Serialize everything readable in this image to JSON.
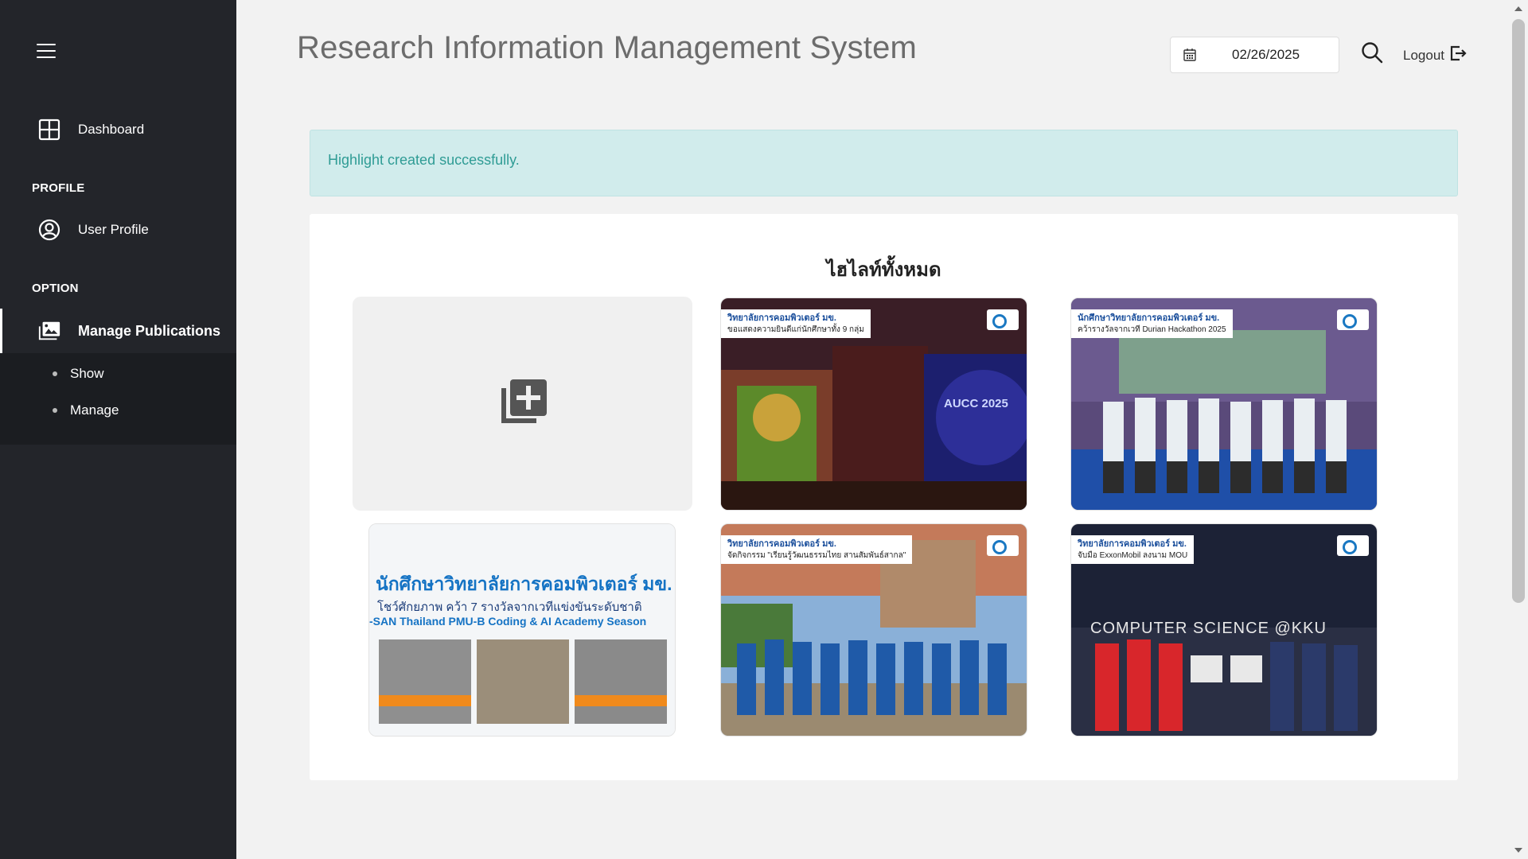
{
  "sidebar": {
    "dashboard_label": "Dashboard",
    "profile_section": "PROFILE",
    "user_profile_label": "User Profile",
    "option_section": "OPTION",
    "manage_publications_label": "Manage Publications",
    "submenu": [
      "Show",
      "Manage"
    ]
  },
  "header": {
    "title": "Research Information Management System",
    "date": "02/26/2025",
    "logout_label": "Logout"
  },
  "alert": {
    "message": "Highlight created successfully."
  },
  "highlights": {
    "title": "ไฮไลท์ทั้งหมด",
    "items": [
      {
        "banner": "วิทยาลัยการคอมพิวเตอร์ มข.",
        "sub": "ขอแสดงความยินดีแก่นักศึกษาทั้ง 9 กลุ่ม",
        "scene": "AUCC 2025"
      },
      {
        "banner": "นักศึกษาวิทยาลัยการคอมพิวเตอร์ มข.",
        "sub": "คว้ารางวัลจากเวที Durian Hackathon 2025",
        "scene": ""
      },
      {
        "banner": "นักศึกษาวิทยาลัยการคอมพิวเตอร์ มข.",
        "sub": "โชว์ศักยภาพ คว้า 7 รางวัลจากเวทีแข่งขันระดับชาติ",
        "scene": "-SAN Thailand PMU-B Coding & AI Academy Season"
      },
      {
        "banner": "วิทยาลัยการคอมพิวเตอร์ มข.",
        "sub": "จัดกิจกรรม \"เรียนรู้วัฒนธรรมไทย สานสัมพันธ์สากล\"",
        "scene": ""
      },
      {
        "banner": "วิทยาลัยการคอมพิวเตอร์ มข.",
        "sub": "จับมือ ExxonMobil ลงนาม MOU",
        "scene": "COMPUTER SCIENCE @KKU"
      }
    ]
  },
  "colors": {
    "sidebar_bg": "#23252a",
    "alert_bg": "#d1ecec",
    "alert_text": "#2f9c95"
  },
  "icons": [
    "menu-icon",
    "dashboard-icon",
    "user-circle-icon",
    "photo-album-icon",
    "calendar-icon",
    "search-icon",
    "logout-icon",
    "add-library-icon"
  ]
}
